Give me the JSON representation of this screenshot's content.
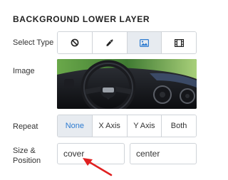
{
  "section": {
    "title": "BACKGROUND LOWER LAYER"
  },
  "select_type": {
    "label": "Select Type",
    "options": [
      {
        "icon": "ban-icon",
        "selected": false
      },
      {
        "icon": "eyedropper-icon",
        "selected": false
      },
      {
        "icon": "image-icon",
        "selected": true
      },
      {
        "icon": "film-icon",
        "selected": false
      }
    ]
  },
  "image": {
    "label": "Image"
  },
  "repeat": {
    "label": "Repeat",
    "options": [
      "None",
      "X Axis",
      "Y Axis",
      "Both"
    ],
    "selected": "None"
  },
  "size_position": {
    "label_line1": "Size &",
    "label_line2": "Position",
    "size_value": "cover",
    "position_value": "center"
  },
  "colors": {
    "accent": "#2d7bd0",
    "active_bg": "#e7ebf0",
    "border": "#cfd3d8",
    "arrow": "#e02020"
  }
}
